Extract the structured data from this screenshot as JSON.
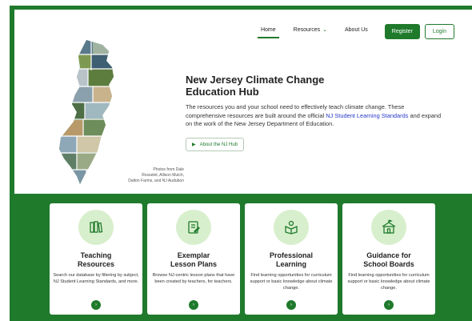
{
  "nav": {
    "items": [
      {
        "label": "Home",
        "active": true
      },
      {
        "label": "Resources",
        "has_dropdown": true
      },
      {
        "label": "About Us"
      }
    ],
    "register_label": "Register",
    "login_label": "Login"
  },
  "hero": {
    "title_line1": "New Jersey Climate Change",
    "title_line2": "Education Hub",
    "desc_part1": "The resources you and your school need to effectively teach climate change. These comprehensive resources are built around the official ",
    "desc_link": "NJ Student Learning Standards",
    "desc_part2": " and expand on the work of the New Jersey Department of Education.",
    "about_button": "About the NJ Hub",
    "photo_credit_line1": "Photos from Dale",
    "photo_credit_line2": "Rosselet, Allison Mulch,",
    "photo_credit_line3": "Dalton Farms, and NJ Audubon"
  },
  "cards": [
    {
      "title_line1": "Teaching",
      "title_line2": "Resources",
      "desc": "Search our database by filtering by subject, NJ Student Learning Standards, and more.",
      "icon": "books-icon"
    },
    {
      "title_line1": "Exemplar",
      "title_line2": "Lesson Plans",
      "desc": "Browse NJ-centric lesson plans that have been created by teachers, for teachers.",
      "icon": "lesson-plan-icon"
    },
    {
      "title_line1": "Professional",
      "title_line2": "Learning",
      "desc": "Find learning opportunities for curriculum support or basic knowledge about climate change.",
      "icon": "reader-icon"
    },
    {
      "title_line1": "Guidance for",
      "title_line2": "School Boards",
      "desc": "Find learning opportunities for curriculum support or basic knowledge about climate change.",
      "icon": "school-icon"
    }
  ],
  "colors": {
    "brand_green": "#1f7a2c",
    "icon_circle": "#d8efcd",
    "link_blue": "#2a39c9"
  }
}
